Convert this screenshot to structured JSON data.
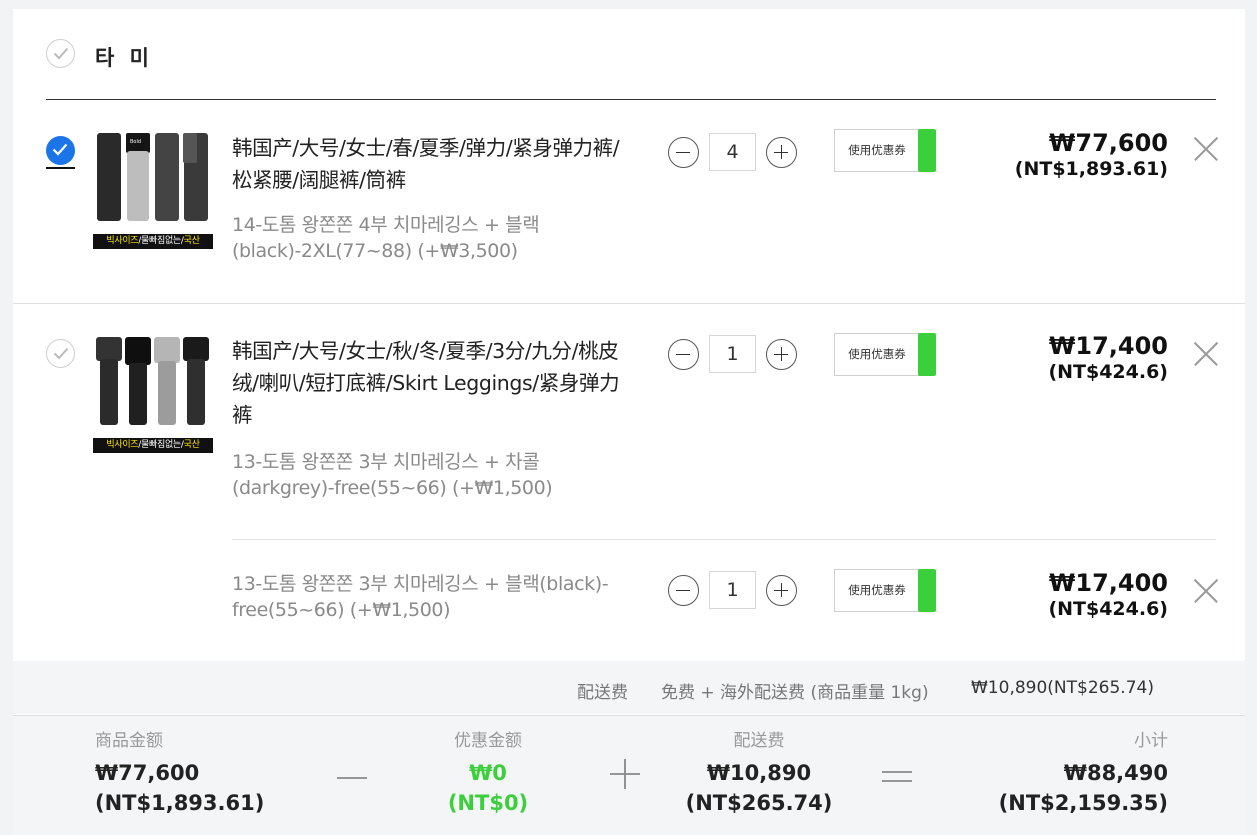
{
  "shop": {
    "name": "타 미"
  },
  "items": [
    {
      "title": "韩国产/大号/女士/春/夏季/弹力/紧身弹力裤/松紧腰/阔腿裤/筒裤",
      "option": "14-도톰 왕쫀쫀 4부 치마레깅스 + 블랙(black)-2XL(77~88) (+₩3,500)",
      "qty": "4",
      "coupon_label": "使用优惠券",
      "price_krw": "₩77,600",
      "price_ntd": "(NT$1,893.61)",
      "checked": true,
      "thumb_band": {
        "a": "빅사이즈",
        "b": "/물빠짐없는/",
        "c": "국산"
      }
    },
    {
      "title": "韩国产/大号/女士/秋/冬/夏季/3分/九分/桃皮绒/喇叭/短打底裤/Skirt Leggings/紧身弹力裤",
      "option": "13-도톰 왕쫀쫀 3부 치마레깅스 + 차콜(darkgrey)-free(55~66) (+₩1,500)",
      "qty": "1",
      "coupon_label": "使用优惠券",
      "price_krw": "₩17,400",
      "price_ntd": "(NT$424.6)",
      "checked": false,
      "thumb_band": {
        "a": "빅사이즈",
        "b": "/물빠짐없는/",
        "c": "국산"
      }
    },
    {
      "option": "13-도톰 왕쫀쫀 3부 치마레깅스 + 블랙(black)-free(55~66) (+₩1,500)",
      "qty": "1",
      "coupon_label": "使用优惠券",
      "price_krw": "₩17,400",
      "price_ntd": "(NT$424.6)"
    }
  ],
  "shipping": {
    "label": "配送费",
    "detail": "免费 + 海外配送费 (商品重量 1kg)",
    "amount": "₩10,890(NT$265.74)"
  },
  "summary": {
    "goods": {
      "label": "商品金额",
      "krw": "₩77,600",
      "ntd": "(NT$1,893.61)"
    },
    "discount": {
      "label": "优惠金额",
      "krw": "₩0",
      "ntd": "(NT$0)"
    },
    "delivery": {
      "label": "配送费",
      "krw": "₩10,890",
      "ntd": "(NT$265.74)"
    },
    "subtotal": {
      "label": "小计",
      "krw": "₩88,490",
      "ntd": "(NT$2,159.35)"
    }
  },
  "colors": {
    "check_blue": "#1b74e8",
    "coupon_green": "#3ccf3c",
    "discount_green": "#3ccf3c"
  }
}
